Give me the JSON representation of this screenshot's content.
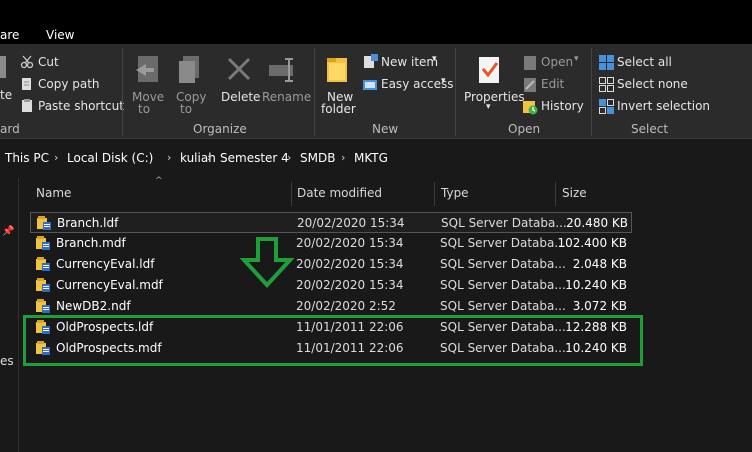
{
  "tabs": {
    "share": "are",
    "view": "View"
  },
  "ribbon": {
    "clipboard": {
      "cut": "Cut",
      "copy_path": "Copy path",
      "paste_shortcut": "Paste shortcut",
      "paste_frag": "te",
      "label_frag": "ard"
    },
    "organize": {
      "move_to": "Move",
      "move_to2": "to",
      "copy_to": "Copy",
      "copy_to2": "to",
      "delete": "Delete",
      "rename": "Rename",
      "label": "Organize"
    },
    "new": {
      "new_folder": "New",
      "new_folder2": "folder",
      "new_item": "New item",
      "easy_access": "Easy access",
      "label": "New"
    },
    "open": {
      "properties": "Properties",
      "open": "Open",
      "edit": "Edit",
      "history": "History",
      "label": "Open"
    },
    "select": {
      "select_all": "Select all",
      "select_none": "Select none",
      "invert_selection": "Invert selection",
      "label": "Select"
    }
  },
  "breadcrumb": [
    "This PC",
    "Local Disk (C:)",
    "kuliah",
    "Semester 4",
    "SMDB",
    "MKTG"
  ],
  "nav_fragment": "es",
  "columns": {
    "name": "Name",
    "date": "Date modified",
    "type": "Type",
    "size": "Size"
  },
  "files": [
    {
      "name": "Branch.ldf",
      "date": "20/02/2020 15:34",
      "type": "SQL Server Databa...",
      "size": "20.480 KB"
    },
    {
      "name": "Branch.mdf",
      "date": "20/02/2020 15:34",
      "type": "SQL Server Databa...",
      "size": "102.400 KB"
    },
    {
      "name": "CurrencyEval.ldf",
      "date": "20/02/2020 15:34",
      "type": "SQL Server Databa...",
      "size": "2.048 KB"
    },
    {
      "name": "CurrencyEval.mdf",
      "date": "20/02/2020 15:34",
      "type": "SQL Server Databa...",
      "size": "10.240 KB"
    },
    {
      "name": "NewDB2.ndf",
      "date": "20/02/2020 2:52",
      "type": "SQL Server Databa...",
      "size": "3.072 KB"
    },
    {
      "name": "OldProspects.ldf",
      "date": "11/01/2011 22:06",
      "type": "SQL Server Databa...",
      "size": "12.288 KB"
    },
    {
      "name": "OldProspects.mdf",
      "date": "11/01/2011 22:06",
      "type": "SQL Server Databa...",
      "size": "10.240 KB"
    }
  ],
  "colors": {
    "highlight": "#1f9e3a",
    "arrow": "#1f9e3a",
    "background": "#191919",
    "ribbon": "#2b2b2b"
  }
}
